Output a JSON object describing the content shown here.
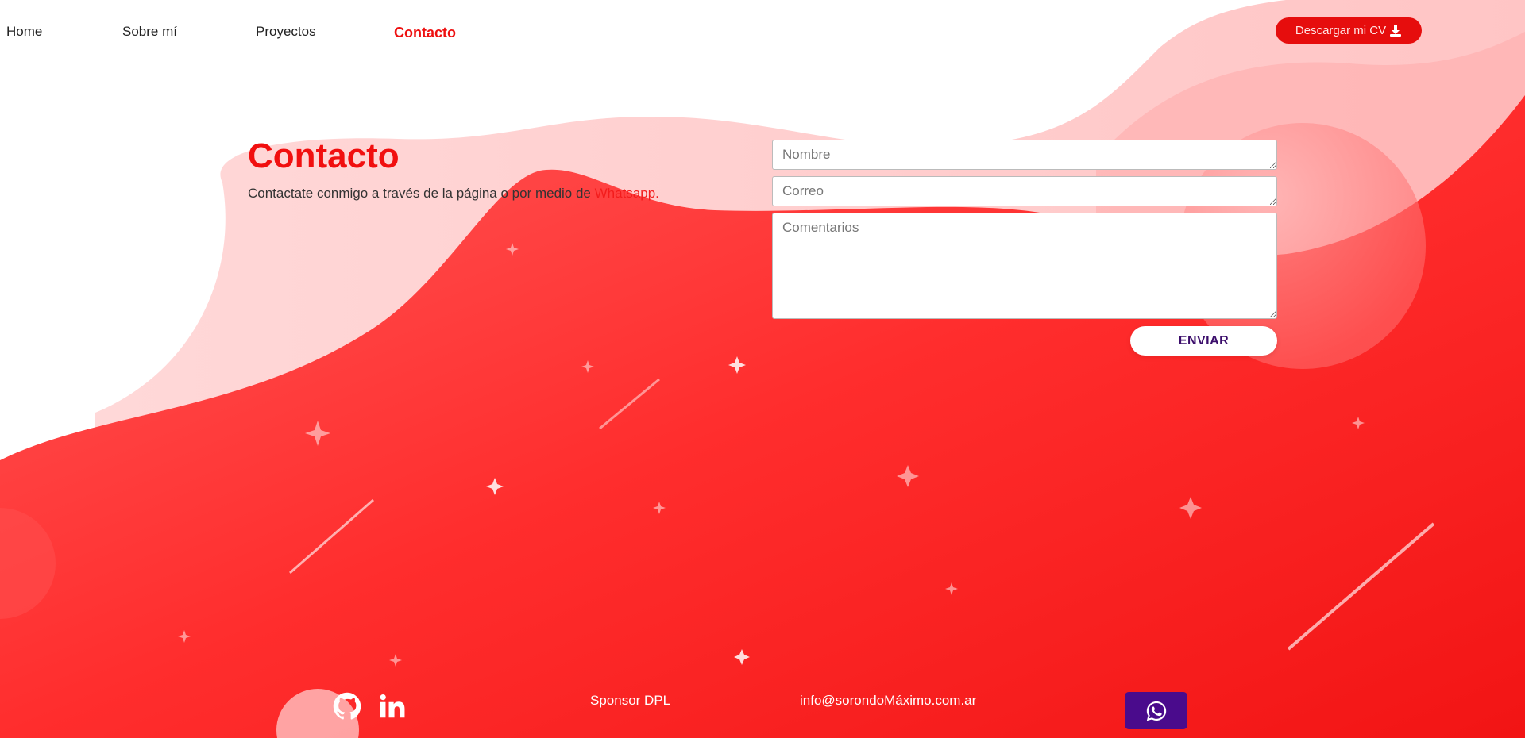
{
  "nav": {
    "items": [
      {
        "label": "Home"
      },
      {
        "label": "Sobre mí"
      },
      {
        "label": "Proyectos"
      },
      {
        "label": "Contacto"
      }
    ],
    "active": "Contacto",
    "cv_button": "Descargar mi CV"
  },
  "contact": {
    "title": "Contacto",
    "subtitle": "Contactate conmigo a través de la página o por medio de",
    "whatsapp_link": "Whatsapp."
  },
  "form": {
    "name_placeholder": "Nombre",
    "email_placeholder": "Correo",
    "comments_placeholder": "Comentarios",
    "submit_label": "ENVIAR"
  },
  "footer": {
    "social_icons": [
      "github-icon",
      "linkedin-icon"
    ],
    "sponsor": "Sponsor DPL",
    "email": "info@sorondoMáximo.com.ar",
    "whatsapp_icon": "whatsapp-icon"
  },
  "colors": {
    "accent": "#f10f0f",
    "background_red": "#ff2a2a",
    "whatsapp_button": "#4a0b8c",
    "submit_text": "#3b0d6b"
  }
}
